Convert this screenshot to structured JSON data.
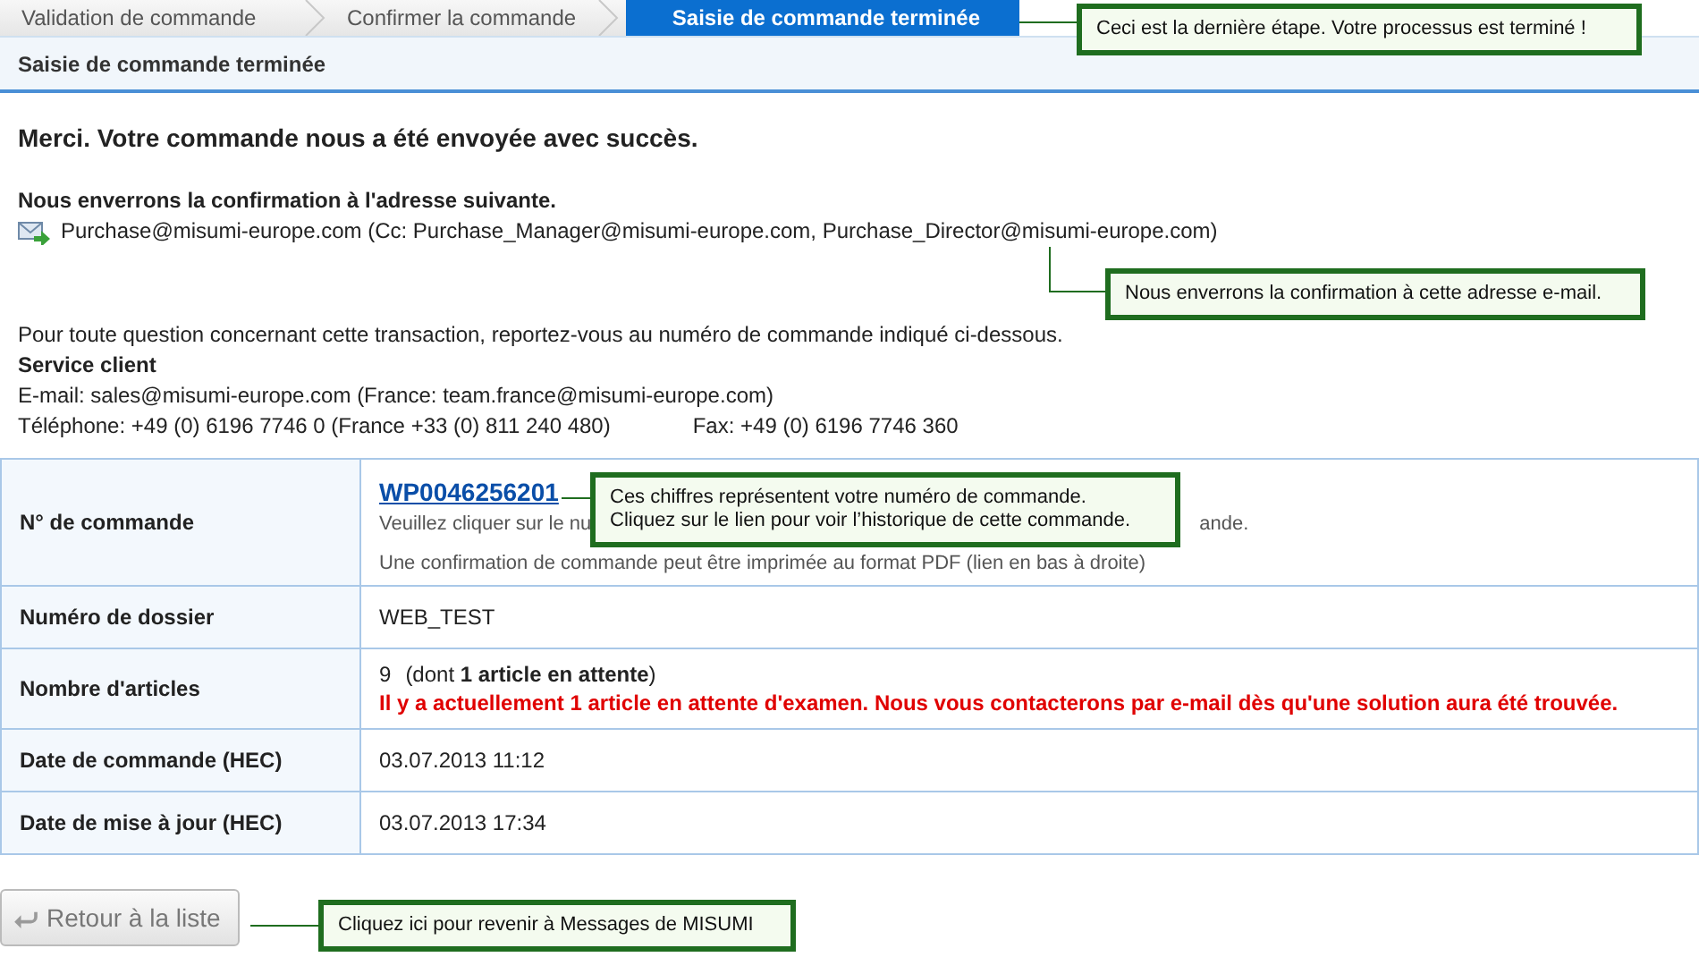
{
  "steps": [
    {
      "label": "Validation de commande",
      "selected": false
    },
    {
      "label": "Confirmer la commande",
      "selected": false
    },
    {
      "label": "Saisie de commande terminée",
      "selected": true
    }
  ],
  "header": {
    "title": "Saisie de commande terminée"
  },
  "thanks": "Merci. Votre commande nous a été envoyée avec succès.",
  "confirmation": {
    "heading": "Nous enverrons la confirmation à l'adresse suivante.",
    "address": "Purchase@misumi-europe.com (Cc: Purchase_Manager@misumi-europe.com, Purchase_Director@misumi-europe.com)"
  },
  "contact": {
    "intro": "Pour toute question concernant cette transaction, reportez-vous au numéro de commande indiqué ci-dessous.",
    "heading": "Service client",
    "email": "E-mail: sales@misumi-europe.com (France: team.france@misumi-europe.com)",
    "phone": "Téléphone: +49 (0) 6196 7746 0 (France +33 (0) 811 240 480)",
    "fax": "Fax: +49 (0) 6196 7746 360"
  },
  "order_table": {
    "rows": [
      {
        "kind": "order",
        "label": "N° de commande",
        "link": "WP0046256201",
        "hint_start": "Veuillez cliquer sur le nu",
        "hint_end": "ande.",
        "note": "Une confirmation de commande peut être imprimée au format PDF (lien en bas à droite)"
      },
      {
        "kind": "plain",
        "label": "Numéro de dossier",
        "value": "WEB_TEST"
      },
      {
        "kind": "articles",
        "label": "Nombre d'articles",
        "count": "9",
        "detail": "(dont **1 article en attente**)",
        "warning": "Il y a actuellement 1 article en attente d'examen. Nous vous contacterons par e-mail dès qu'une solution aura été trouvée."
      },
      {
        "kind": "plain",
        "label": "Date de commande (HEC)",
        "value": "03.07.2013 11:12"
      },
      {
        "kind": "plain",
        "label": "Date de mise à jour (HEC)",
        "value": "03.07.2013 17:34"
      }
    ]
  },
  "back_button": {
    "label": "Retour à la liste"
  },
  "callouts": [
    {
      "kind": "step",
      "lines": [
        "Ceci est la dernière étape. Votre processus est terminé !"
      ]
    },
    {
      "kind": "email",
      "lines": [
        "Nous enverrons la confirmation à cette adresse e-mail."
      ]
    },
    {
      "kind": "order",
      "lines": [
        "Ces chiffres représentent votre numéro de commande.",
        "Cliquez sur le lien pour voir l’historique de cette commande."
      ]
    },
    {
      "kind": "back",
      "lines": [
        "Cliquez ici pour revenir à Messages de MISUMI"
      ]
    }
  ]
}
